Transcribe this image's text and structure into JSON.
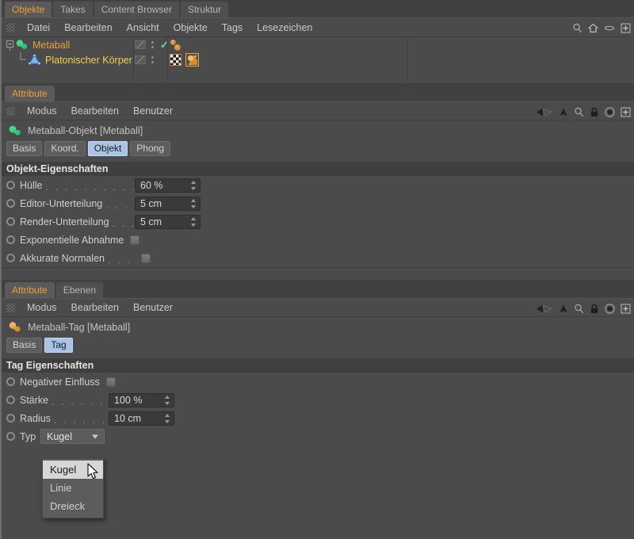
{
  "object_manager": {
    "tabs": [
      {
        "label": "Objekte",
        "active": true
      },
      {
        "label": "Takes",
        "active": false
      },
      {
        "label": "Content Browser",
        "active": false
      },
      {
        "label": "Struktur",
        "active": false
      }
    ],
    "menu": [
      "Datei",
      "Bearbeiten",
      "Ansicht",
      "Objekte",
      "Tags",
      "Lesezeichen"
    ],
    "toolbar_icons": [
      "search-icon",
      "home-icon",
      "eye-icon",
      "plus-box-icon"
    ],
    "tree": [
      {
        "name": "Metaball",
        "level": 0,
        "icon": "metaball-object-icon",
        "color": "#e8a33d",
        "has_check": true
      },
      {
        "name": "Platonischer Körper",
        "level": 1,
        "icon": "platonic-object-icon",
        "color": "#f2d24a",
        "has_check": false
      }
    ]
  },
  "attr_object": {
    "tabs": [
      {
        "label": "Attribute",
        "active": true
      }
    ],
    "menu": [
      "Modus",
      "Bearbeiten",
      "Benutzer"
    ],
    "toolbar_icons": [
      "back-arrow-icon",
      "up-arrow-icon",
      "search-icon",
      "lock-icon",
      "target-icon",
      "plus-box-icon"
    ],
    "title": "Metaball-Objekt [Metaball]",
    "pills": [
      {
        "label": "Basis",
        "selected": false
      },
      {
        "label": "Koord.",
        "selected": false
      },
      {
        "label": "Objekt",
        "selected": true
      },
      {
        "label": "Phong",
        "selected": false
      }
    ],
    "section_title": "Objekt-Eigenschaften",
    "properties": [
      {
        "label": "Hülle",
        "type": "number",
        "value": "60 %",
        "leader": ". . . . . . . . . . . . . . . ."
      },
      {
        "label": "Editor-Unterteilung",
        "type": "number",
        "value": "5 cm",
        "leader": ". . . . ."
      },
      {
        "label": "Render-Unterteilung",
        "type": "number",
        "value": "5 cm",
        "leader": ". . ."
      },
      {
        "label": "Exponentielle Abnahme",
        "type": "checkbox",
        "value": "",
        "leader": ""
      },
      {
        "label": "Akkurate Normalen",
        "type": "checkbox",
        "value": "",
        "leader": ". . . ."
      }
    ]
  },
  "attr_tag": {
    "tabs": [
      {
        "label": "Attribute",
        "active": true
      },
      {
        "label": "Ebenen",
        "active": false
      }
    ],
    "menu": [
      "Modus",
      "Bearbeiten",
      "Benutzer"
    ],
    "toolbar_icons": [
      "back-arrow-icon",
      "up-arrow-icon",
      "search-icon",
      "lock-icon",
      "target-icon",
      "plus-box-icon"
    ],
    "title": "Metaball-Tag [Metaball]",
    "pills": [
      {
        "label": "Basis",
        "selected": false
      },
      {
        "label": "Tag",
        "selected": true
      }
    ],
    "section_title": "Tag Eigenschaften",
    "properties": [
      {
        "label": "Negativer Einfluss",
        "type": "checkbox",
        "value": "",
        "leader": ""
      },
      {
        "label": "Stärke",
        "type": "number",
        "value": "100 %",
        "leader": ". . . . . . . . . . ."
      },
      {
        "label": "Radius",
        "type": "number",
        "value": "10 cm",
        "leader": ". . . . . . . . . . ."
      },
      {
        "label": "Typ",
        "type": "combo",
        "value": "Kugel",
        "leader": ""
      }
    ],
    "dropdown": {
      "open": true,
      "selected": "Kugel",
      "options": [
        {
          "label": "Kugel",
          "highlighted": true
        },
        {
          "label": "Linie",
          "highlighted": false
        },
        {
          "label": "Dreieck",
          "highlighted": false
        }
      ]
    }
  },
  "colors": {
    "accent_orange": "#f0a030",
    "tree_metaball": "#e8a33d",
    "tree_platonic": "#f2d24a",
    "selected_pill": "#a9c4e4",
    "panel_bg": "#4b4b4b",
    "section_bg": "#3f3f3f",
    "check_green": "#5ae0a0"
  }
}
